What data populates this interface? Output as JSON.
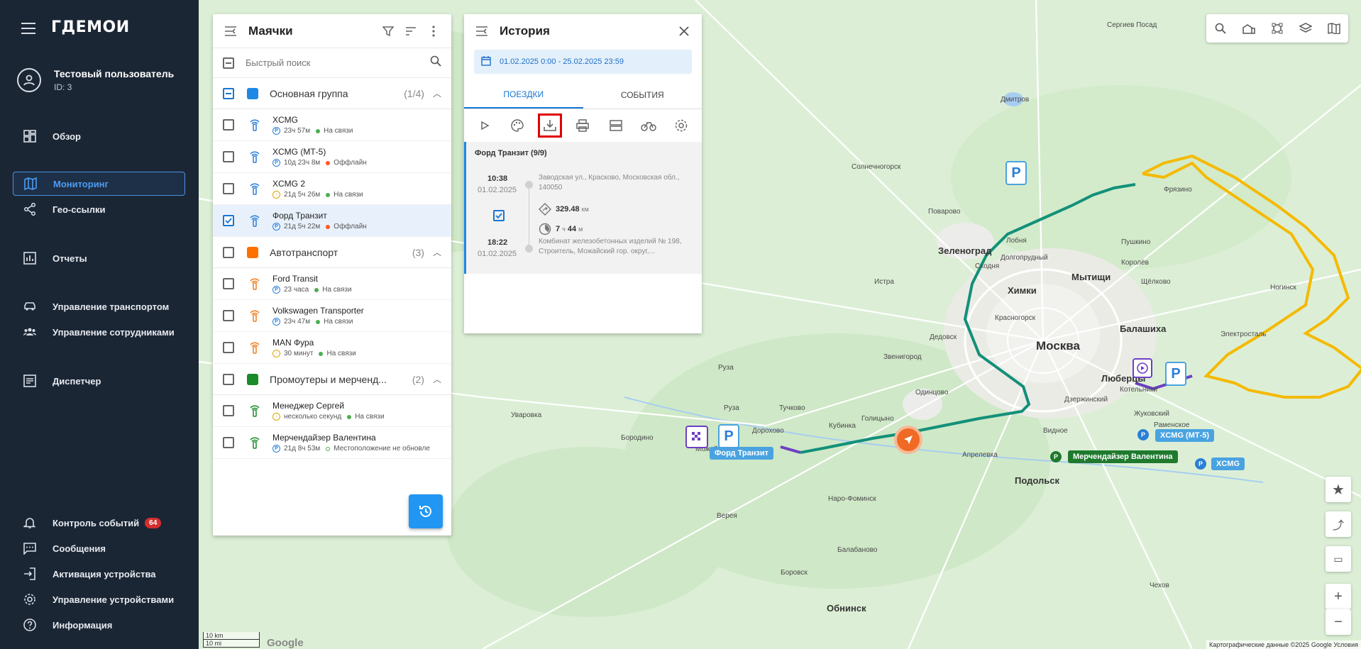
{
  "app": {
    "logo": "ГДЕМОИ"
  },
  "user": {
    "name": "Тестовый пользователь",
    "id": "ID: 3"
  },
  "nav": {
    "overview": "Обзор",
    "monitoring": "Мониторинг",
    "geolinks": "Гео-ссылки",
    "reports": "Отчеты",
    "transport": "Управление транспортом",
    "staff": "Управление сотрудниками",
    "dispatcher": "Диспетчер",
    "events": "Контроль событий",
    "events_badge": "64",
    "messages": "Сообщения",
    "activation": "Активация устройства",
    "devices": "Управление устройствами",
    "info": "Информация"
  },
  "beacons": {
    "title": "Маячки",
    "search_placeholder": "Быстрый поиск",
    "groups": [
      {
        "name": "Основная группа",
        "count": "(1/4)",
        "color": "#1e88e5",
        "devices": [
          {
            "name": "XCMG",
            "time": "23ч 57м",
            "status": "На связи"
          },
          {
            "name": "XCMG (МТ-5)",
            "time": "10д 23ч 8м",
            "status": "Оффлайн"
          },
          {
            "name": "XCMG 2",
            "time": "21д 5ч 26м",
            "status": "На связи"
          },
          {
            "name": "Форд Транзит",
            "time": "21д 5ч 22м",
            "status": "Оффлайн"
          }
        ]
      },
      {
        "name": "Автотранспорт",
        "count": "(3)",
        "color": "#ff6f00",
        "devices": [
          {
            "name": "Ford Transit",
            "time": "23 часа",
            "status": "На связи"
          },
          {
            "name": "Volkswagen Transporter",
            "time": "23ч 47м",
            "status": "На связи"
          },
          {
            "name": "MAN Фура",
            "time": "30 минут",
            "status": "На связи"
          }
        ]
      },
      {
        "name": "Промоутеры и мерченд...",
        "count": "(2)",
        "color": "#1b8a2a",
        "devices": [
          {
            "name": "Менеджер Сергей",
            "time": "несколько секунд",
            "status": "На связи"
          },
          {
            "name": "Мерчендайзер Валентина",
            "time": "21д 8ч 53м",
            "status": "Местоположение не обновле"
          }
        ]
      }
    ]
  },
  "history": {
    "title": "История",
    "date_range": "01.02.2025 0:00 - 25.02.2025 23:59",
    "tabs": [
      "ПОЕЗДКИ",
      "СОБЫТИЯ"
    ],
    "trip_header": "Форд Транзит (9/9)",
    "trip": {
      "start_time": "10:38",
      "start_date": "01.02.2025",
      "start_addr": "Заводская ул., Красково, Московская обл., 140050",
      "distance": "329.48",
      "distance_unit": "км",
      "duration_h": "7",
      "duration_h_unit": "ч",
      "duration_m": "44",
      "duration_m_unit": "м",
      "end_time": "18:22",
      "end_date": "01.02.2025",
      "end_addr": "Комбинат железобетонных изделий № 198, Строитель, Можайский гор. округ,..."
    }
  },
  "map": {
    "places": [
      "Москва",
      "Зеленоград",
      "Химки",
      "Мытищи",
      "Балашиха",
      "Люберцы",
      "Подольск",
      "Обнинск",
      "Одинцово",
      "Звенигород",
      "Истра",
      "Дзержинский",
      "Котельники",
      "Красногорск",
      "Можайск",
      "Руза",
      "Дедовск",
      "Королёв",
      "Щёлково",
      "Пушкино",
      "Фрязино",
      "Электросталь",
      "Жуковский",
      "Раменское",
      "Видное",
      "Наро-Фоминск",
      "Апрелевка",
      "Кубинка",
      "Голицыно",
      "Лобня",
      "Долгопрудный",
      "Сходня",
      "Поварово",
      "Солнечногорск",
      "Дмитров",
      "Верея",
      "Боровск",
      "Балабаново",
      "Руза",
      "Тучково",
      "Дорохово",
      "Бородино",
      "Уваровка",
      "Чехов",
      "Сергиев Посад",
      "Ногинск"
    ],
    "tags": [
      {
        "label": "Форд Транзит"
      },
      {
        "label": "XCMG (МТ-5)"
      },
      {
        "label": "Мерчендайзер Валентина"
      },
      {
        "label": "XCMG"
      }
    ],
    "attribution": "Картографические данные ©2025 Google   Условия",
    "scale_km": "10 km",
    "scale_mi": "10 mi",
    "google": "Google"
  }
}
